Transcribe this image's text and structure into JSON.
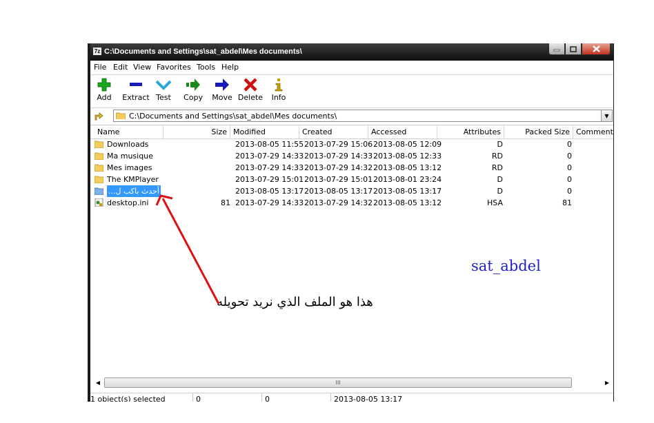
{
  "window": {
    "title": "C:\\Documents and Settings\\sat_abdel\\Mes documents\\",
    "app_icon": "7z",
    "controls": {
      "minimize": "minimize-icon",
      "maximize": "maximize-icon",
      "close": "close-icon"
    }
  },
  "menu": [
    "File",
    "Edit",
    "View",
    "Favorites",
    "Tools",
    "Help"
  ],
  "toolbar": [
    {
      "label": "Add",
      "icon": "add-icon",
      "color": "#1aa81a"
    },
    {
      "label": "Extract",
      "icon": "extract-icon",
      "color": "#1a1ab8"
    },
    {
      "label": "Test",
      "icon": "test-icon",
      "color": "#2aa7d8"
    },
    {
      "label": "Copy",
      "icon": "copy-icon",
      "color": "#1a8a1a"
    },
    {
      "label": "Move",
      "icon": "move-icon",
      "color": "#1a1ab8"
    },
    {
      "label": "Delete",
      "icon": "delete-icon",
      "color": "#d01010"
    },
    {
      "label": "Info",
      "icon": "info-icon",
      "color": "#c8a000"
    }
  ],
  "address": {
    "path": "C:\\Documents and Settings\\sat_abdel\\Mes documents\\"
  },
  "columns": [
    "Name",
    "Size",
    "Modified",
    "Created",
    "Accessed",
    "Attributes",
    "Packed Size",
    "Comment"
  ],
  "files": [
    {
      "name": "Downloads",
      "size": "",
      "modified": "2013-08-05 11:55",
      "created": "2013-07-29 15:06",
      "accessed": "2013-08-05 12:09",
      "attributes": "D",
      "packed": "0",
      "icon": "folder-icon",
      "selected": false
    },
    {
      "name": "Ma musique",
      "size": "",
      "modified": "2013-07-29 14:33",
      "created": "2013-07-29 14:33",
      "accessed": "2013-08-05 12:33",
      "attributes": "RD",
      "packed": "0",
      "icon": "folder-icon",
      "selected": false
    },
    {
      "name": "Mes images",
      "size": "",
      "modified": "2013-07-29 14:33",
      "created": "2013-07-29 14:32",
      "accessed": "2013-08-05 13:12",
      "attributes": "RD",
      "packed": "0",
      "icon": "folder-icon",
      "selected": false
    },
    {
      "name": "The KMPlayer",
      "size": "",
      "modified": "2013-07-29 15:01",
      "created": "2013-07-29 15:01",
      "accessed": "2013-08-01 23:24",
      "attributes": "D",
      "packed": "0",
      "icon": "folder-icon",
      "selected": false
    },
    {
      "name": "...أحدث باكب ل",
      "size": "",
      "modified": "2013-08-05 13:17",
      "created": "2013-08-05 13:17",
      "accessed": "2013-08-05 13:17",
      "attributes": "D",
      "packed": "0",
      "icon": "folder-icon",
      "selected": true
    },
    {
      "name": "desktop.ini",
      "size": "81",
      "modified": "2013-07-29 14:33",
      "created": "2013-07-29 14:32",
      "accessed": "2013-08-05 13:12",
      "attributes": "HSA",
      "packed": "81",
      "icon": "ini-file-icon",
      "selected": false
    }
  ],
  "scrollbar": {
    "thumb_grip": "III"
  },
  "status": {
    "selected": "1 object(s) selected",
    "size": "0",
    "packed": "0",
    "modified": "2013-08-05 13:17"
  },
  "annotations": {
    "watermark": "sat_abdel",
    "note": "هذا هو الملف الذي نريد تحويله",
    "arrow_color": "#e01010"
  }
}
